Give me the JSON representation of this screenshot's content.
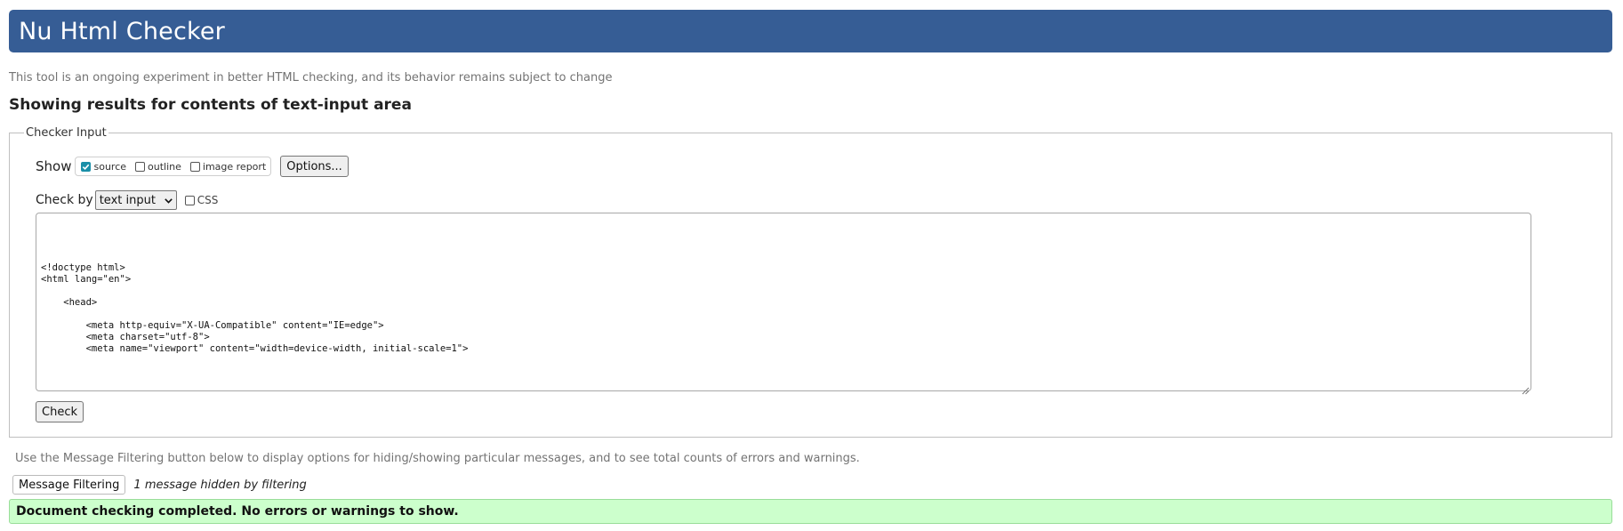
{
  "header": {
    "title": "Nu Html Checker"
  },
  "tagline": "This tool is an ongoing experiment in better HTML checking, and its behavior remains subject to change",
  "results_heading": "Showing results for contents of text-input area",
  "checker_input": {
    "legend": "Checker Input",
    "show_label": "Show",
    "show_options": [
      {
        "label": "source",
        "checked": true
      },
      {
        "label": "outline",
        "checked": false
      },
      {
        "label": "image report",
        "checked": false
      }
    ],
    "options_button": "Options...",
    "check_by_label": "Check by",
    "check_by_selected": "text input",
    "css_label": "CSS",
    "css_checked": false,
    "textarea_value": "<!doctype html>\n<html lang=\"en\">\n\n    <head>\n\n        <meta http-equiv=\"X-UA-Compatible\" content=\"IE=edge\">\n        <meta charset=\"utf-8\">\n        <meta name=\"viewport\" content=\"width=device-width, initial-scale=1\">",
    "check_button": "Check"
  },
  "filter": {
    "note": "Use the Message Filtering button below to display options for hiding/showing particular messages, and to see total counts of errors and warnings.",
    "button": "Message Filtering",
    "hidden_count_text": "1 message hidden by filtering"
  },
  "status": {
    "message": "Document checking completed. No errors or warnings to show."
  },
  "colors": {
    "header_bg": "#365d95",
    "success_bg": "#ccffcc",
    "checkbox_checked": "#1a8fa8"
  }
}
